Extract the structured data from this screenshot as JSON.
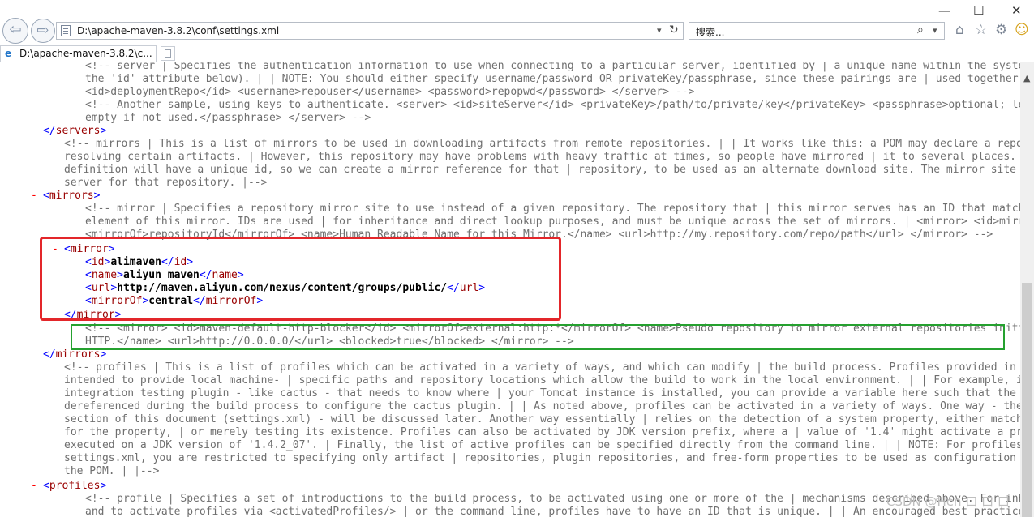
{
  "window": {
    "minimize": "—",
    "maximize": "☐",
    "close": "✕"
  },
  "toolbar": {
    "back_icon": "arrow-left",
    "forward_icon": "arrow-right",
    "address": "D:\\apache-maven-3.8.2\\conf\\settings.xml",
    "dropdown": "▾",
    "refresh": "↻",
    "search_placeholder": "搜索...",
    "search_icon": "⌕",
    "home": "⌂",
    "favorites": "☆",
    "tools": "⚙",
    "smiley": "☺"
  },
  "tab": {
    "icon": "e",
    "title": "D:\\apache-maven-3.8.2\\c..."
  },
  "xml": {
    "l1": "<!-- server | Specifies the authentication information to use when connecting to a particular server, identified by | a unique name within the system (referred to by",
    "l2": "the 'id' attribute below). | | NOTE: You should either specify username/password OR privateKey/passphrase, since these pairings are | used together. | <server>",
    "l3": "<id>deploymentRepo</id> <username>repouser</username> <password>repopwd</password> </server> -->",
    "l4": "<!-- Another sample, using keys to authenticate. <server> <id>siteServer</id> <privateKey>/path/to/private/key</privateKey> <passphrase>optional; leave",
    "l5": "empty if not used.</passphrase> </server> -->",
    "servers_close": "servers",
    "l6": "<!-- mirrors | This is a list of mirrors to be used in downloading artifacts from remote repositories. | | It works like this: a POM may declare a repository to use in",
    "l7": "resolving certain artifacts. | However, this repository may have problems with heavy traffic at times, so people have mirrored | it to several places. | | That repository",
    "l8": "definition will have a unique id, so we can create a mirror reference for that | repository, to be used as an alternate download site. The mirror site will be the preferred |",
    "l9": "server for that repository. |-->",
    "minus": "-",
    "mirrors_open": "mirrors",
    "l10": "<!-- mirror | Specifies a repository mirror site to use instead of a given repository. The repository that | this mirror serves has an ID that matches the mirrorOf",
    "l11": "element of this mirror. IDs are used | for inheritance and direct lookup purposes, and must be unique across the set of mirrors. | <mirror> <id>mirrorId</id>",
    "l12": "<mirrorOf>repositoryId</mirrorOf> <name>Human Readable Name for this Mirror.</name> <url>http://my.repository.com/repo/path</url> </mirror> -->",
    "mirror_tag": "mirror",
    "id_tag": "id",
    "id_val": "alimaven",
    "name_tag": "name",
    "name_val": "aliyun maven",
    "url_tag": "url",
    "url_val": "http://maven.aliyun.com/nexus/content/groups/public/",
    "mirrorof_tag": "mirrorOf",
    "mirrorof_val": "central",
    "l13": "<!-- <mirror> <id>maven-default-http-blocker</id> <mirrorOf>external:http:*</mirrorOf> <name>Pseudo repository to mirror external repositories initially using",
    "l14": "HTTP.</name> <url>http://0.0.0.0/</url> <blocked>true</blocked> </mirror> -->",
    "mirrors_close": "mirrors",
    "l15": "<!-- profiles | This is a list of profiles which can be activated in a variety of ways, and which can modify | the build process. Profiles provided in the settings.xml are",
    "l16": "intended to provide local machine- | specific paths and repository locations which allow the build to work in the local environment. | | For example, if you have an",
    "l17": "integration testing plugin - like cactus - that needs to know where | your Tomcat instance is installed, you can provide a variable here such that the variable is |",
    "l18": "dereferenced during the build process to configure the cactus plugin. | | As noted above, profiles can be activated in a variety of ways. One way - the activeProfiles |",
    "l19": "section of this document (settings.xml) - will be discussed later. Another way essentially | relies on the detection of a system property, either matching a particular value",
    "l20": "for the property, | or merely testing its existence. Profiles can also be activated by JDK version prefix, where a | value of '1.4' might activate a profile when the build is",
    "l21": "executed on a JDK version of '1.4.2_07'. | Finally, the list of active profiles can be specified directly from the command line. | | NOTE: For profiles defined in the",
    "l22": "settings.xml, you are restricted to specifying only artifact | repositories, plugin repositories, and free-form properties to be used as configuration | variables for plugins in",
    "l23": "the POM. | |-->",
    "profiles_open": "profiles",
    "l24": "<!-- profile | Specifies a set of introductions to the build process, to be activated using one or more of the | mechanisms described above. For inheritance purposes,",
    "l25": "and to activate profiles via <activatedProfiles/> | or the command line, profiles have to have an ID that is unique. | | An encouraged best practice for profile"
  },
  "watermark": "CSDN @Hen 口 口 口",
  "colors": {
    "comment": "#6f6f6f",
    "tag": "#990000",
    "markup": "#0000ff",
    "minus": "#ff0000",
    "highlight_red": "#e3262a",
    "highlight_green": "#25a12f"
  }
}
